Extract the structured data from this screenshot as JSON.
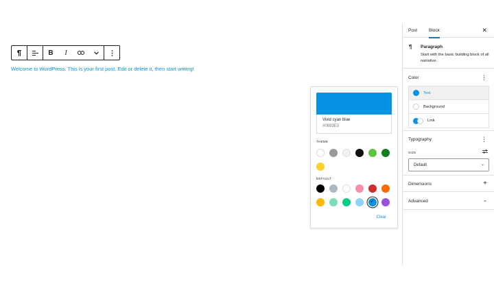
{
  "toolbar": {
    "items": [
      "paragraph-icon",
      "align-left-icon",
      "bold-icon",
      "italic-icon",
      "link-icon",
      "chevron-down-icon",
      "more-vertical-icon"
    ],
    "bold_label": "B",
    "italic_label": "I"
  },
  "content": {
    "paragraph": "Welcome to WordPress. This is your first post. Edit or delete it, then start writing!"
  },
  "popover": {
    "selected_color_name": "Vivid cyan blue",
    "selected_color_hex": "#0693E3",
    "theme_label": "THEME",
    "default_label": "DEFAULT",
    "clear_label": "Clear",
    "theme_colors": [
      "#ffffff",
      "#999999",
      "#f2f2f2",
      "#111111",
      "#5ac43d",
      "#117f1f",
      "#fcd22a"
    ],
    "default_colors": [
      "#000000",
      "#abb8c3",
      "#ffffff",
      "#f78da7",
      "#cf2e2e",
      "#ff6900",
      "#fcb900",
      "#7bdcb5",
      "#00d084",
      "#8ed1fc",
      "#0693e3",
      "#9b51e0"
    ],
    "selected_index": 10
  },
  "sidebar": {
    "tabs": [
      "Post",
      "Block"
    ],
    "active_tab": "Block",
    "close_icon": "close-icon",
    "block": {
      "title": "Paragraph",
      "description": "Start with the basic building block of all narrative."
    },
    "color": {
      "title": "Color",
      "items": [
        "Text",
        "Background",
        "Link"
      ]
    },
    "typography": {
      "title": "Typography",
      "size_label": "SIZE",
      "size_value": "Default"
    },
    "dimensions": {
      "title": "Dimensions"
    },
    "advanced": {
      "title": "Advanced"
    }
  },
  "colors": {
    "accent": "#0693e3",
    "border": "#e0e0e0",
    "tab_indicator": "#007cba"
  }
}
